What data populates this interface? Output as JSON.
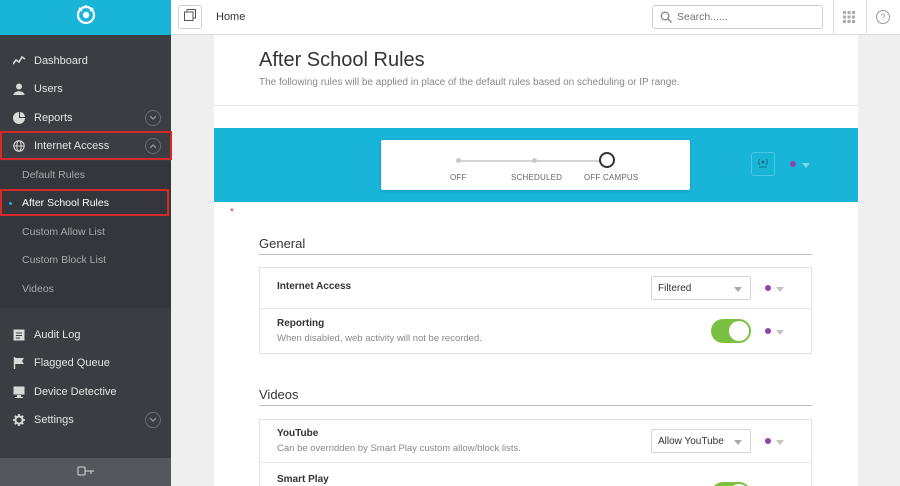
{
  "app": {
    "brand_color": "#19b5d8",
    "highlight_color": "#d6292a"
  },
  "topbar": {
    "breadcrumb": "Home",
    "search_placeholder": "Search......"
  },
  "sidebar": {
    "items": [
      {
        "label": "Dashboard",
        "icon": "chart-line-icon"
      },
      {
        "label": "Users",
        "icon": "user-icon"
      },
      {
        "label": "Reports",
        "icon": "pie-chart-icon"
      },
      {
        "label": "Internet Access",
        "icon": "globe-icon"
      }
    ],
    "sub_items": [
      {
        "label": "Default Rules"
      },
      {
        "label": "After School Rules"
      },
      {
        "label": "Custom Allow List"
      },
      {
        "label": "Custom Block List"
      },
      {
        "label": "Videos"
      }
    ],
    "lower_items": [
      {
        "label": "Audit Log",
        "icon": "list-icon"
      },
      {
        "label": "Flagged Queue",
        "icon": "flag-icon"
      },
      {
        "label": "Device Detective",
        "icon": "device-icon"
      },
      {
        "label": "Settings",
        "icon": "gear-icon"
      }
    ]
  },
  "page": {
    "title": "After School Rules",
    "subtitle": "The following rules will be applied in place of the default rules based on scheduling or IP range."
  },
  "mode_toggle": {
    "options": [
      "OFF",
      "SCHEDULED",
      "OFF CAMPUS"
    ],
    "selected": "OFF CAMPUS"
  },
  "required_marker": "*",
  "sections": {
    "general": {
      "title": "General",
      "rows": {
        "internet_access": {
          "title": "Internet Access",
          "value": "Filtered"
        },
        "reporting": {
          "title": "Reporting",
          "description": "When disabled, web activity will not be recorded.",
          "enabled": true
        }
      }
    },
    "videos": {
      "title": "Videos",
      "rows": {
        "youtube": {
          "title": "YouTube",
          "description": "Can be overridden by Smart Play custom allow/block lists.",
          "value": "Allow YouTube"
        },
        "smart_play": {
          "title": "Smart Play",
          "enabled": true
        }
      }
    }
  }
}
